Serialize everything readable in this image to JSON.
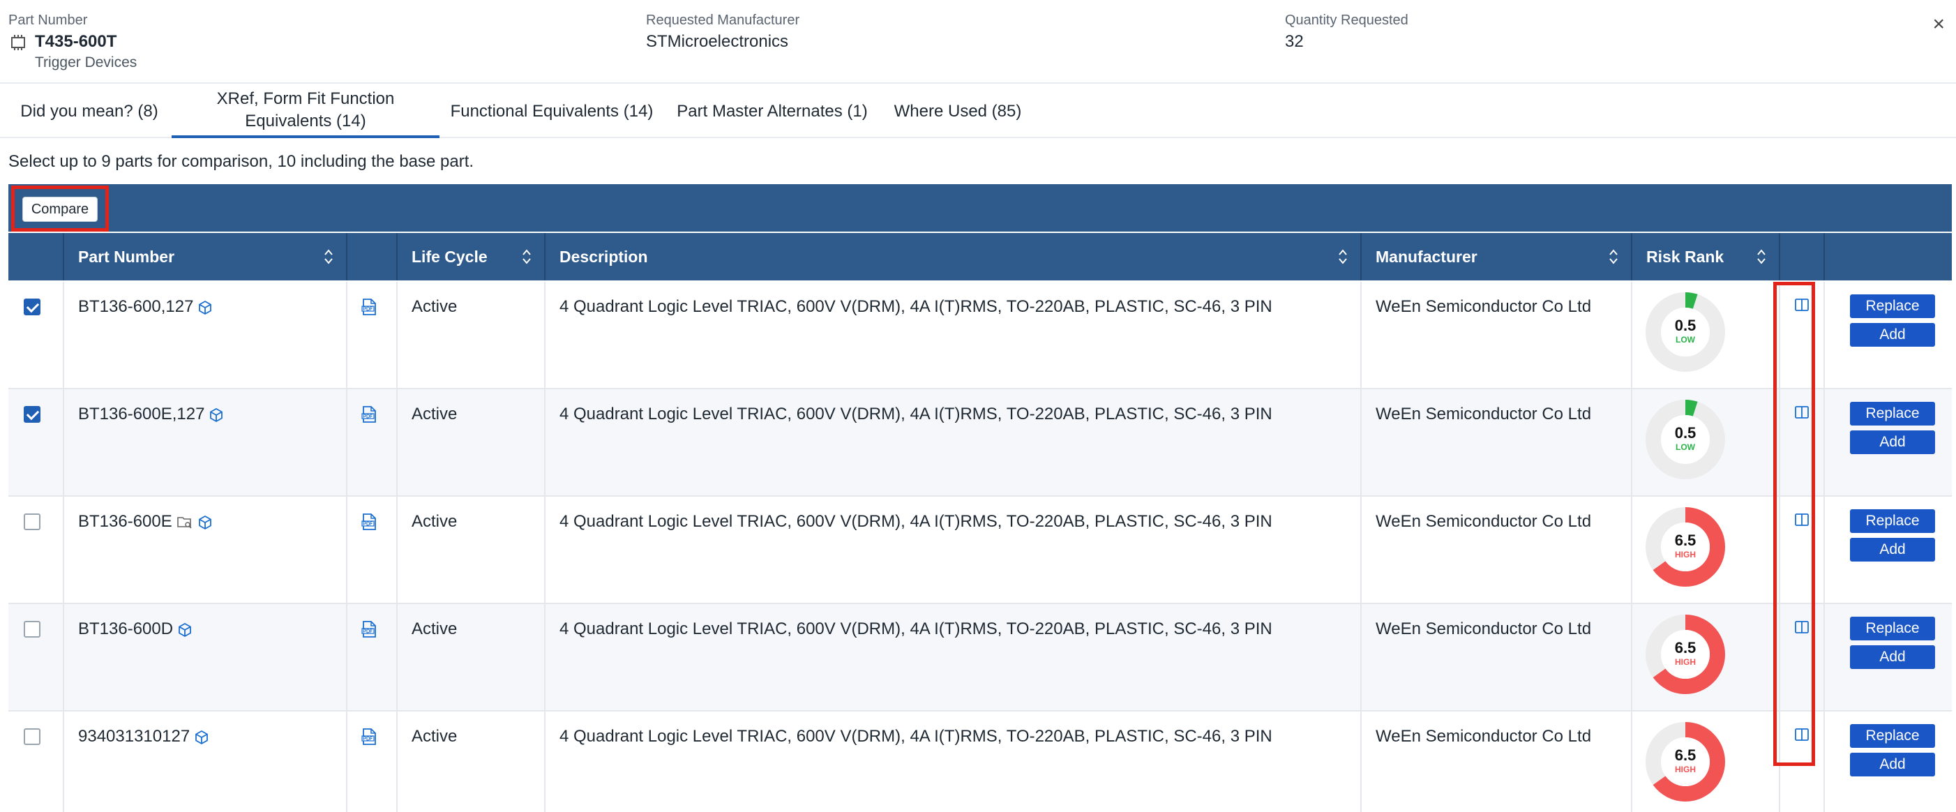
{
  "header": {
    "part_number_label": "Part Number",
    "part_number": "T435-600T",
    "part_category": "Trigger Devices",
    "manufacturer_label": "Requested Manufacturer",
    "manufacturer": "STMicroelectronics",
    "quantity_label": "Quantity Requested",
    "quantity": "32",
    "close_icon": "×"
  },
  "tabs": [
    {
      "label": "Did you mean? (8)"
    },
    {
      "label": "XRef, Form Fit Function Equivalents (14)",
      "active": true
    },
    {
      "label": "Functional Equivalents (14)"
    },
    {
      "label": "Part Master Alternates (1)"
    },
    {
      "label": "Where Used (85)"
    }
  ],
  "hint": "Select up to 9 parts for comparison, 10 including the base part.",
  "toolbar": {
    "compare_label": "Compare"
  },
  "columns": {
    "part_number": "Part Number",
    "life_cycle": "Life Cycle",
    "description": "Description",
    "manufacturer": "Manufacturer",
    "risk_rank": "Risk Rank"
  },
  "actions": {
    "replace": "Replace",
    "add": "Add"
  },
  "rows": [
    {
      "checked": true,
      "part": "BT136-600,127",
      "folder_icon": false,
      "life_cycle": "Active",
      "description": "4 Quadrant Logic Level TRIAC, 600V V(DRM), 4A I(T)RMS, TO-220AB, PLASTIC, SC-46, 3 PIN",
      "manufacturer": "WeEn Semiconductor Co Ltd",
      "risk": "0.5",
      "risk_level": "LOW",
      "risk_fraction": 0.05
    },
    {
      "checked": true,
      "part": "BT136-600E,127",
      "folder_icon": false,
      "life_cycle": "Active",
      "description": "4 Quadrant Logic Level TRIAC, 600V V(DRM), 4A I(T)RMS, TO-220AB, PLASTIC, SC-46, 3 PIN",
      "manufacturer": "WeEn Semiconductor Co Ltd",
      "risk": "0.5",
      "risk_level": "LOW",
      "risk_fraction": 0.05
    },
    {
      "checked": false,
      "part": "BT136-600E",
      "folder_icon": true,
      "life_cycle": "Active",
      "description": "4 Quadrant Logic Level TRIAC, 600V V(DRM), 4A I(T)RMS, TO-220AB, PLASTIC, SC-46, 3 PIN",
      "manufacturer": "WeEn Semiconductor Co Ltd",
      "risk": "6.5",
      "risk_level": "HIGH",
      "risk_fraction": 0.65
    },
    {
      "checked": false,
      "part": "BT136-600D",
      "folder_icon": false,
      "life_cycle": "Active",
      "description": "4 Quadrant Logic Level TRIAC, 600V V(DRM), 4A I(T)RMS, TO-220AB, PLASTIC, SC-46, 3 PIN",
      "manufacturer": "WeEn Semiconductor Co Ltd",
      "risk": "6.5",
      "risk_level": "HIGH",
      "risk_fraction": 0.65
    },
    {
      "checked": false,
      "part": "934031310127",
      "folder_icon": false,
      "life_cycle": "Active",
      "description": "4 Quadrant Logic Level TRIAC, 600V V(DRM), 4A I(T)RMS, TO-220AB, PLASTIC, SC-46, 3 PIN",
      "manufacturer": "WeEn Semiconductor Co Ltd",
      "risk": "6.5",
      "risk_level": "HIGH",
      "risk_fraction": 0.65
    }
  ],
  "colors": {
    "header_bg": "#2f5a8c",
    "accent": "#1a56c6",
    "low": "#2bb34a",
    "high": "#f25454",
    "highlight": "#e2231a"
  }
}
